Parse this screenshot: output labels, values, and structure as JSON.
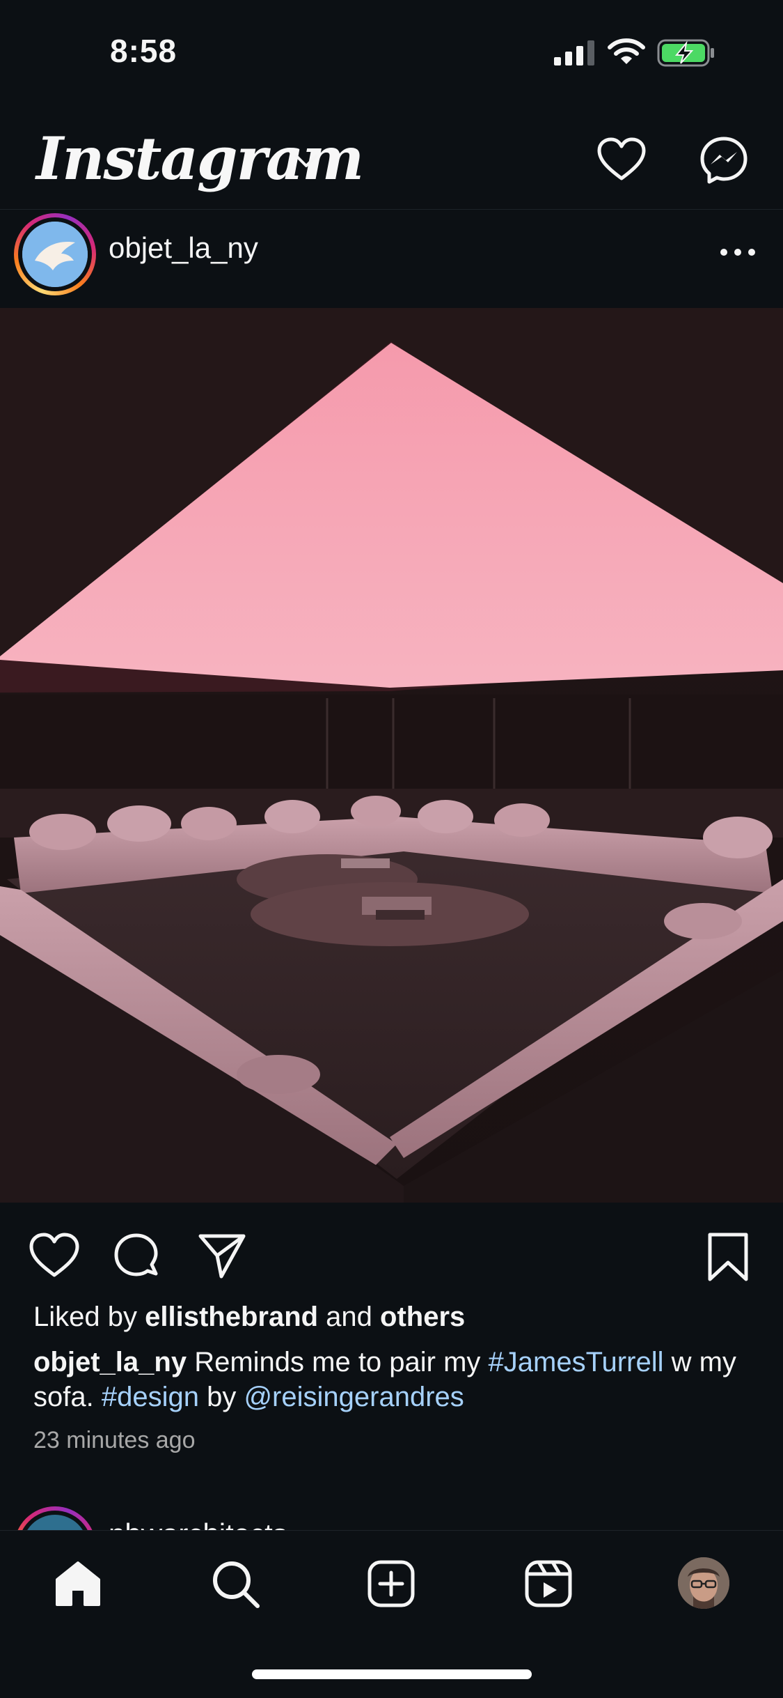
{
  "status_bar": {
    "time": "8:58",
    "icons": [
      "cellular-signal-icon",
      "wifi-icon",
      "battery-charging-icon"
    ],
    "battery_color": "#4cd964"
  },
  "header": {
    "logo_text": "Instagram",
    "icons": [
      "chevron-down-icon",
      "heart-icon",
      "messenger-icon"
    ]
  },
  "post": {
    "username": "objet_la_ny",
    "liked_by": {
      "prefix": "Liked by ",
      "user": "ellisthebrand",
      "middle": " and ",
      "others": "others"
    },
    "caption": {
      "username": "objet_la_ny",
      "text_1": " Reminds me to pair my ",
      "hashtag_1": "#JamesTurrell",
      "text_2": " w my sofa. ",
      "hashtag_2": "#design",
      "text_3": " by ",
      "mention": "@reisingerandres"
    },
    "timestamp": "23 minutes ago",
    "action_icons": [
      "heart-icon",
      "comment-icon",
      "share-icon",
      "bookmark-icon"
    ]
  },
  "next_post": {
    "username": "nbwarchitects"
  },
  "tab_bar": {
    "icons": [
      "home-icon",
      "search-icon",
      "create-icon",
      "reels-icon",
      "profile-avatar"
    ]
  },
  "colors": {
    "background": "#0c1014",
    "link": "#a6d1fb",
    "secondary_text": "#a8a8a8",
    "skylight_pink": "#f4a3b3"
  }
}
